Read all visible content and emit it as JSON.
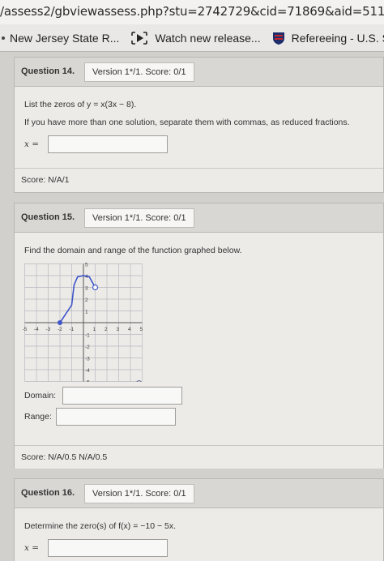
{
  "browser": {
    "url": "/assess2/gbviewassess.php?stu=2742729&cid=71869&aid=51193",
    "bookmarks": [
      {
        "label": "New Jersey State R...",
        "icon": "dot-icon"
      },
      {
        "label": "Watch new release...",
        "icon": "play-icon"
      },
      {
        "label": "Refereeing - U.S. S",
        "icon": "shield-icon"
      }
    ]
  },
  "questions": [
    {
      "number": "Question 14.",
      "version": "Version 1*/1. Score: 0/1",
      "prompt": "List the zeros of y = x(3x − 8).",
      "note": "If you have more than one solution, separate them with commas, as reduced fractions.",
      "answer_label": "x =",
      "answer_value": "",
      "score": "Score: N/A/1"
    },
    {
      "number": "Question 15.",
      "version": "Version 1*/1. Score: 0/1",
      "prompt": "Find the domain and range of the function graphed below.",
      "domain_label": "Domain:",
      "domain_value": "",
      "range_label": "Range:",
      "range_value": "",
      "score": "Score: N/A/0.5 N/A/0.5",
      "graph": {
        "x_ticks": [
          "-5",
          "-4",
          "-3",
          "-2",
          "-1",
          "1",
          "2",
          "3",
          "4",
          "5"
        ],
        "y_ticks": [
          "5",
          "4",
          "3",
          "2",
          "1",
          "-1",
          "-2",
          "-3",
          "-4",
          "-5"
        ],
        "xlim": [
          -5,
          5
        ],
        "ylim": [
          -5,
          5
        ],
        "curve_points": [
          [
            -2,
            0
          ],
          [
            -1,
            1.5
          ],
          [
            -0.8,
            3.2
          ],
          [
            -0.5,
            3.9
          ],
          [
            0,
            4
          ],
          [
            0.5,
            3.9
          ],
          [
            1,
            3
          ]
        ],
        "closed_point": [
          -2,
          0
        ],
        "open_point": [
          1,
          3
        ],
        "curve_color": "#3f55c9",
        "zoom_icon": "magnifier-icon"
      }
    },
    {
      "number": "Question 16.",
      "version": "Version 1*/1. Score: 0/1",
      "prompt": "Determine the zero(s) of f(x) = −10 − 5x.",
      "answer_label": "x =",
      "answer_value": ""
    }
  ]
}
